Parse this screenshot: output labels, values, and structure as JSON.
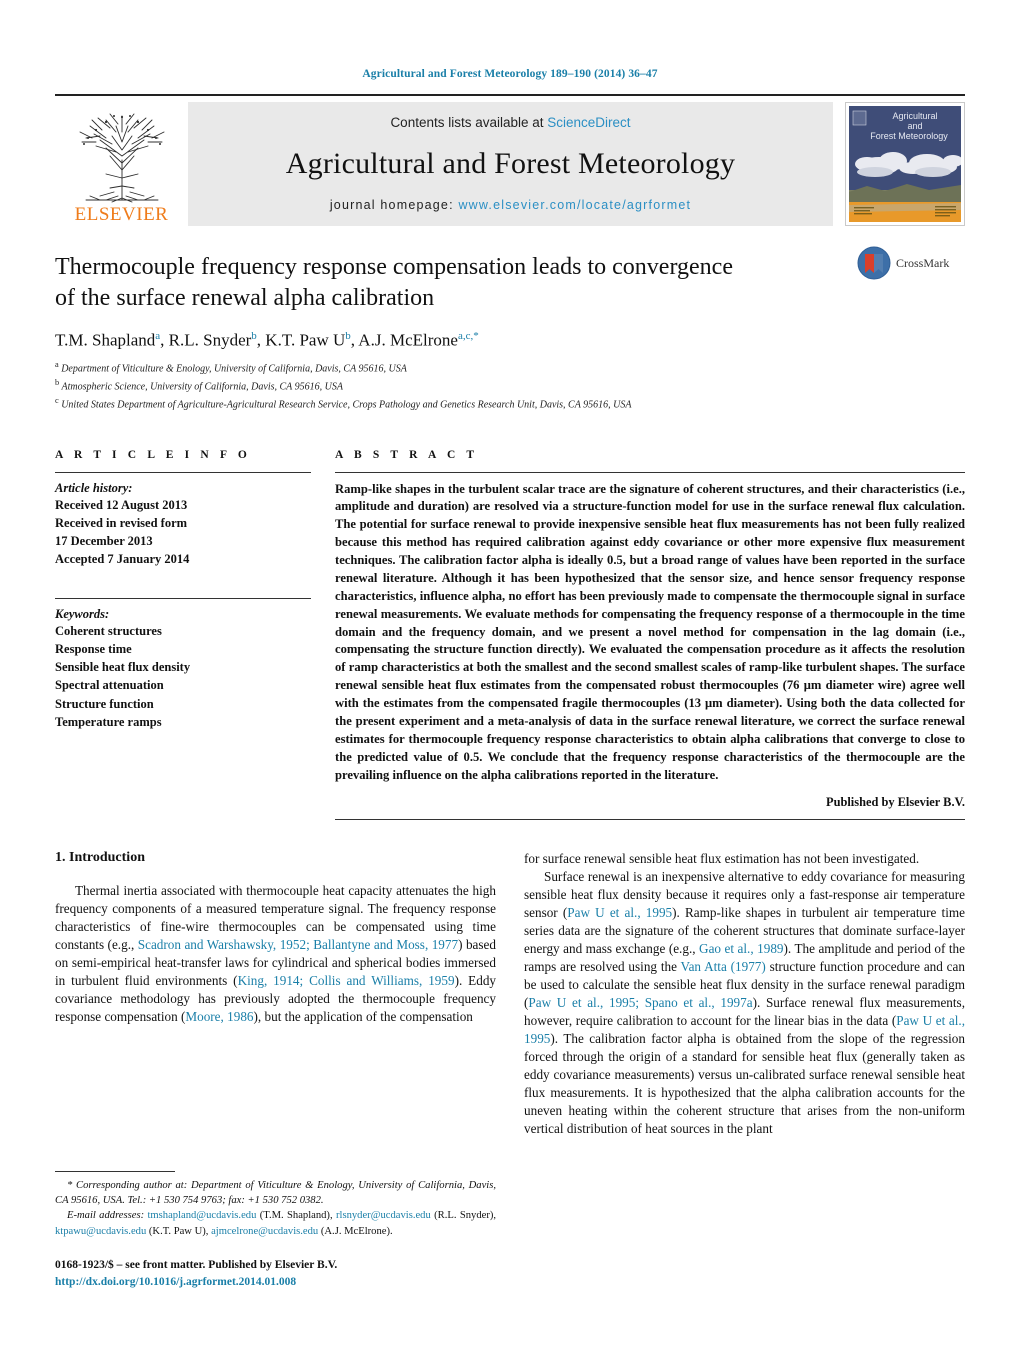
{
  "running_head": "Agricultural and Forest Meteorology 189–190 (2014) 36–47",
  "masthead": {
    "contents_prefix": "Contents lists available at ",
    "sciencedirect": "ScienceDirect",
    "journal_title": "Agricultural and Forest Meteorology",
    "homepage_prefix": "journal homepage: ",
    "homepage_url": "www.elsevier.com/locate/agrformet",
    "publisher_wordmark": "ELSEVIER",
    "cover_title_line1": "Agricultural",
    "cover_title_line2": "and",
    "cover_title_line3": "Forest Meteorology",
    "accent_color": "#2b8fc4",
    "elsevier_orange": "#ef7c1b"
  },
  "article": {
    "title": "Thermocouple frequency response compensation leads to convergence of the surface renewal alpha calibration",
    "authors_html": "T.M. Shapland<sup>a</sup>, R.L. Snyder<sup>b</sup>, K.T. Paw U<sup>b</sup>, A.J. McElrone<sup>a,c,*</sup>",
    "affiliations": [
      "a Department of Viticulture & Enology, University of California, Davis, CA 95616, USA",
      "b Atmospheric Science, University of California, Davis, CA 95616, USA",
      "c United States Department of Agriculture-Agricultural Research Service, Crops Pathology and Genetics Research Unit, Davis, CA 95616, USA"
    ],
    "crossmark_label": "CrossMark"
  },
  "info": {
    "heading": "A R T I C L E   I N F O",
    "history_label": "Article history:",
    "history": [
      "Received 12 August 2013",
      "Received in revised form",
      "17 December 2013",
      "Accepted 7 January 2014"
    ],
    "keywords_label": "Keywords:",
    "keywords": [
      "Coherent structures",
      "Response time",
      "Sensible heat flux density",
      "Spectral attenuation",
      "Structure function",
      "Temperature ramps"
    ]
  },
  "abstract": {
    "heading": "A B S T R A C T",
    "text": "Ramp-like shapes in the turbulent scalar trace are the signature of coherent structures, and their characteristics (i.e., amplitude and duration) are resolved via a structure-function model for use in the surface renewal flux calculation. The potential for surface renewal to provide inexpensive sensible heat flux measurements has not been fully realized because this method has required calibration against eddy covariance or other more expensive flux measurement techniques. The calibration factor alpha is ideally 0.5, but a broad range of values have been reported in the surface renewal literature. Although it has been hypothesized that the sensor size, and hence sensor frequency response characteristics, influence alpha, no effort has been previously made to compensate the thermocouple signal in surface renewal measurements. We evaluate methods for compensating the frequency response of a thermocouple in the time domain and the frequency domain, and we present a novel method for compensation in the lag domain (i.e., compensating the structure function directly). We evaluated the compensation procedure as it affects the resolution of ramp characteristics at both the smallest and the second smallest scales of ramp-like turbulent shapes. The surface renewal sensible heat flux estimates from the compensated robust thermocouples (76 μm diameter wire) agree well with the estimates from the compensated fragile thermocouples (13 μm diameter). Using both the data collected for the present experiment and a meta-analysis of data in the surface renewal literature, we correct the surface renewal estimates for thermocouple frequency response characteristics to obtain alpha calibrations that converge to close to the predicted value of 0.5. We conclude that the frequency response characteristics of the thermocouple are the prevailing influence on the alpha calibrations reported in the literature.",
    "published_by": "Published by Elsevier B.V."
  },
  "body": {
    "section_number_title": "1.  Introduction",
    "left_para_1_seg1": "Thermal inertia associated with thermocouple heat capacity attenuates the high frequency components of a measured temperature signal. The frequency response characteristics of fine-wire thermocouples can be compensated using time constants (e.g., ",
    "left_para_1_ref1": "Scadron and Warshawsky, 1952; Ballantyne and Moss, 1977",
    "left_para_1_seg2": ") based on semi-empirical heat-transfer laws for cylindrical and spherical bodies immersed in turbulent fluid environments (",
    "left_para_1_ref2": "King, 1914; Collis and Williams, 1959",
    "left_para_1_seg3": "). Eddy covariance methodology has previously adopted the thermocouple frequency response compensation (",
    "left_para_1_ref3": "Moore, 1986",
    "left_para_1_seg4": "), but the application of the compensation",
    "right_para_1": "for surface renewal sensible heat flux estimation has not been investigated.",
    "right_para_2_seg1": "Surface renewal is an inexpensive alternative to eddy covariance for measuring sensible heat flux density because it requires only a fast-response air temperature sensor (",
    "right_para_2_ref1": "Paw U et al., 1995",
    "right_para_2_seg2": "). Ramp-like shapes in turbulent air temperature time series data are the signature of the coherent structures that dominate surface-layer energy and mass exchange (e.g., ",
    "right_para_2_ref2": "Gao et al., 1989",
    "right_para_2_seg3": "). The amplitude and period of the ramps are resolved using the ",
    "right_para_2_ref3": "Van Atta (1977)",
    "right_para_2_seg4": " structure function procedure and can be used to calculate the sensible heat flux density in the surface renewal paradigm (",
    "right_para_2_ref4": "Paw U et al., 1995; Spano et al., 1997a",
    "right_para_2_seg5": "). Surface renewal flux measurements, however, require calibration to account for the linear bias in the data (",
    "right_para_2_ref5": "Paw U et al., 1995",
    "right_para_2_seg6": "). The calibration factor alpha is obtained from the slope of the regression forced through the origin of a standard for sensible heat flux (generally taken as eddy covariance measurements) versus un-calibrated surface renewal sensible heat flux measurements. It is hypothesized that the alpha calibration accounts for the uneven heating within the coherent structure that arises from the non-uniform vertical distribution of heat sources in the plant"
  },
  "footnote": {
    "corresponding_seg1": "* Corresponding author at: Department of Viticulture & Enology, University of California, Davis, CA 95616, USA. Tel.: +1 530 754 9763; fax: +1 530 752 0382.",
    "email_label": "E-mail addresses:",
    "emails": [
      {
        "address": "tmshapland@ucdavis.edu",
        "owner": "(T.M. Shapland),"
      },
      {
        "address": "rlsnyder@ucdavis.edu",
        "owner": "(R.L. Snyder),"
      },
      {
        "address": "ktpawu@ucdavis.edu",
        "owner": "(K.T. Paw U),"
      },
      {
        "address": "ajmcelrone@ucdavis.edu",
        "owner": "(A.J. McElrone)."
      }
    ],
    "issn_line": "0168-1923/$ – see front matter. Published by Elsevier B.V.",
    "doi_line": "http://dx.doi.org/10.1016/j.agrformet.2014.01.008"
  }
}
